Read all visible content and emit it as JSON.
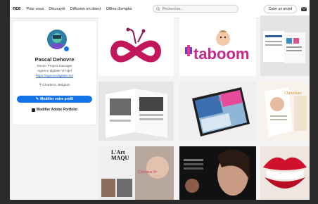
{
  "topbar": {
    "logo": "nce",
    "nav": [
      "Pour vous",
      "Découvrir",
      "Diffusion en direct",
      "Offres d'emploi"
    ],
    "search_placeholder": "Rechercher...",
    "create_button": "Créer un projet"
  },
  "profile": {
    "name": "Pascal Dehovre",
    "role": "Senior Project manager",
    "company": "Agence digitale VII sprl",
    "website": "https://agencedigitale.be/",
    "location": "Charleroi, Belgium",
    "edit_profile_button": "Modifier votre profil",
    "edit_portfolio_button": "Modifier Adobe Portfolio"
  },
  "thumbnails": {
    "taboom_text": "taboom",
    "digital_tablet_text": "DIGITA",
    "magazine_title_line1": "L'Art",
    "magazine_title_line2": "MAQU",
    "magazine_subtitle": "Cheveux br",
    "beauty_title": "Chevelure"
  },
  "colors": {
    "accent": "#1473e6",
    "frame": "#2b2b2b",
    "infinity_logo": "#c2185b"
  }
}
